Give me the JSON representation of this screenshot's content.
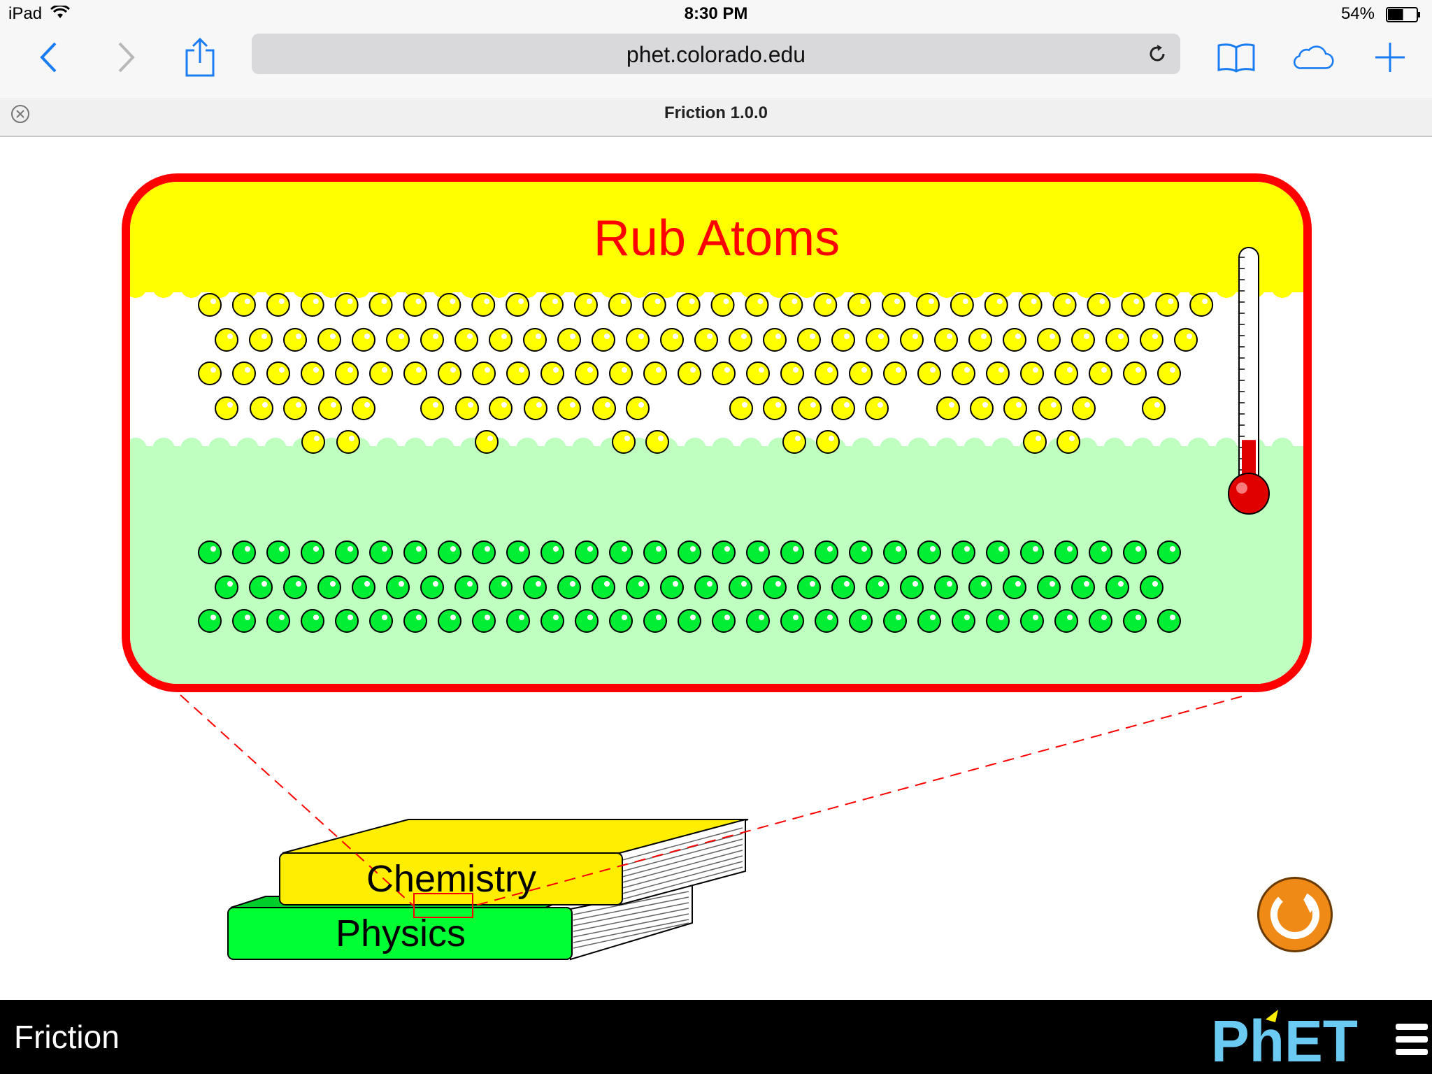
{
  "status_bar": {
    "device": "iPad",
    "time": "8:30 PM",
    "battery": "54%",
    "battery_level": 0.54
  },
  "toolbar": {
    "url": "phet.colorado.edu",
    "icons": [
      "back-icon",
      "forward-icon",
      "share-icon",
      "reload-icon",
      "bookmarks-icon",
      "icloud-tabs-icon",
      "new-tab-icon"
    ]
  },
  "tab": {
    "title": "Friction 1.0.0"
  },
  "sim": {
    "zoom_title": "Rub Atoms",
    "books": {
      "top": "Chemistry",
      "bottom": "Physics"
    },
    "thermometer_level": 0.12,
    "colors": {
      "frame": "#ff0000",
      "top_surface": "#ffff00",
      "bottom_surface": "#bfffbf",
      "top_atom": "#ffff00",
      "bottom_atom": "#00ee33",
      "chemistry_book": "#ffee00",
      "physics_book": "#00ff33",
      "reset": "#f08a16"
    }
  },
  "navbar": {
    "sim_title": "Friction",
    "logo": "PhET"
  }
}
